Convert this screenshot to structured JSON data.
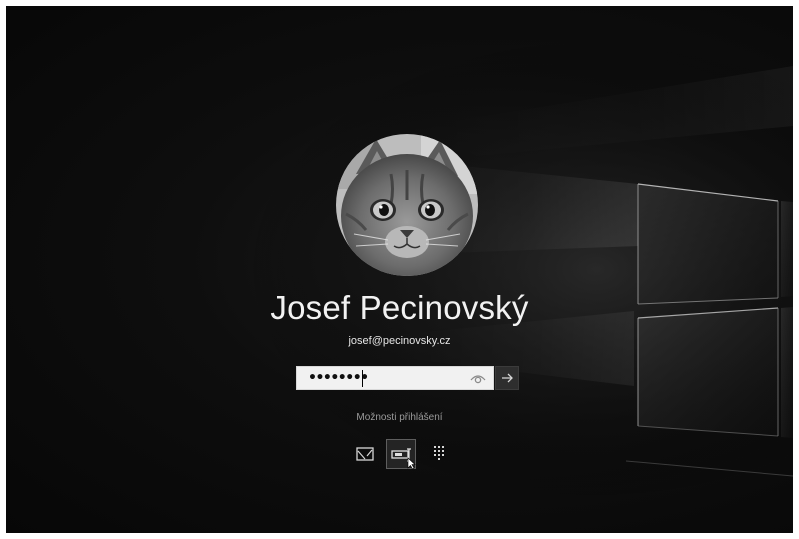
{
  "user": {
    "name": "Josef Pecinovský",
    "email": "josef@pecinovsky.cz",
    "avatar_icon": "cat-avatar"
  },
  "password": {
    "masked_value": "••••••••",
    "reveal_icon": "eye-icon",
    "submit_icon": "arrow-right-icon"
  },
  "signin_options": {
    "label": "Možnosti přihlášení",
    "options": [
      {
        "icon": "picture-password-icon",
        "selected": false
      },
      {
        "icon": "password-key-icon",
        "selected": true
      },
      {
        "icon": "pin-keypad-icon",
        "selected": false
      }
    ]
  },
  "colors": {
    "background": "#0e0e0e",
    "text": "#f2f2f2",
    "input_background": "#f1f1f1",
    "submit_background": "#2e2e2e"
  }
}
